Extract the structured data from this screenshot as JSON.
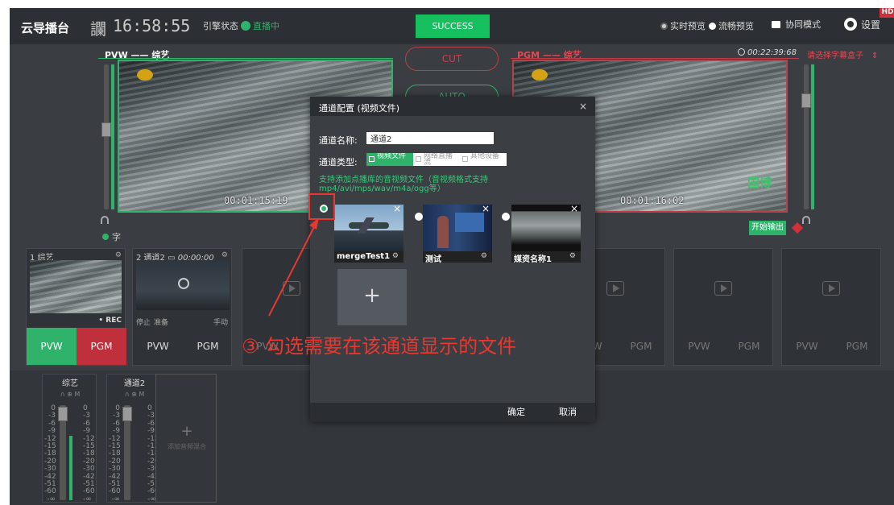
{
  "topbar": {
    "app_title": "云导播台",
    "clock_glyph": "讕",
    "clock": "16:58:55",
    "engine_label": "引擎状态",
    "engine_status": "直播中",
    "success_button": "SUCCESS",
    "preview_realtime": "实时预览",
    "preview_smooth": "流畅预览",
    "collab_mode": "协同模式",
    "settings": "设置",
    "hd_badge": "HD"
  },
  "pvw": {
    "label": "PVW —— 综艺",
    "timecode": "00:01:15:19",
    "subtitle_label": "字"
  },
  "pgm": {
    "label": "PGM —— 综艺",
    "elapsed": "00:22:39:68",
    "caption_select": "请选择字幕盒子",
    "timecode": "00:01:16:02",
    "watermark": "国博",
    "start_output": "开始输出"
  },
  "switcher": {
    "cut": "CUT",
    "auto": "AUTO"
  },
  "channels": [
    {
      "title": "1 综艺",
      "rec": "• REC",
      "pvw": "PVW",
      "pgm": "PGM"
    },
    {
      "title": "2 通道2",
      "time": "00:00:00",
      "stop": "停止",
      "ready": "准备",
      "manual": "手动",
      "pvw": "PVW",
      "pgm": "PGM"
    },
    {
      "pvw": "PVW",
      "pgm": "PGM"
    },
    {
      "pvw": "PVW",
      "pgm": "PGM"
    },
    {
      "pvw": "PVW",
      "pgm": "PGM"
    },
    {
      "pvw": "PVW",
      "pgm": "PGM"
    }
  ],
  "mixers": [
    {
      "name": "综艺",
      "icons": "∩ ⊕ M",
      "scale": [
        "0",
        "-3",
        "-6",
        "-9",
        "-12",
        "-15",
        "-18",
        "-20",
        "-30",
        "-42",
        "-51",
        "-60",
        "-∞"
      ]
    },
    {
      "name": "通道2",
      "icons": "∩ ⊕ M",
      "scale": [
        "0",
        "-3",
        "-6",
        "-9",
        "-12",
        "-15",
        "-18",
        "-20",
        "-30",
        "-42",
        "-51",
        "-60",
        "-∞"
      ]
    }
  ],
  "add_mixer": "添加音频混合",
  "dialog": {
    "title": "通道配置 (视频文件)",
    "close": "×",
    "name_label": "通道名称:",
    "name_value": "通道2",
    "type_label": "通道类型:",
    "type_options": [
      "视频文件",
      "网络直播流",
      "其他设备"
    ],
    "hint": "支持添加点播库的音视频文件（音视频格式支持mp4/avi/mps/wav/m4a/ogg等）",
    "files": [
      {
        "name": "mergeTest1",
        "checked": true
      },
      {
        "name": "测试",
        "checked": false
      },
      {
        "name": "媒资名称1",
        "checked": false
      }
    ],
    "add_icon": "+",
    "confirm": "确定",
    "cancel": "取消"
  },
  "annotation": "③ 勾选需要在该通道显示的文件",
  "colors": {
    "accent_green": "#2fb36a",
    "success_green": "#17c05f",
    "annotation_red": "#e8382f",
    "danger_red": "#c0444f"
  }
}
